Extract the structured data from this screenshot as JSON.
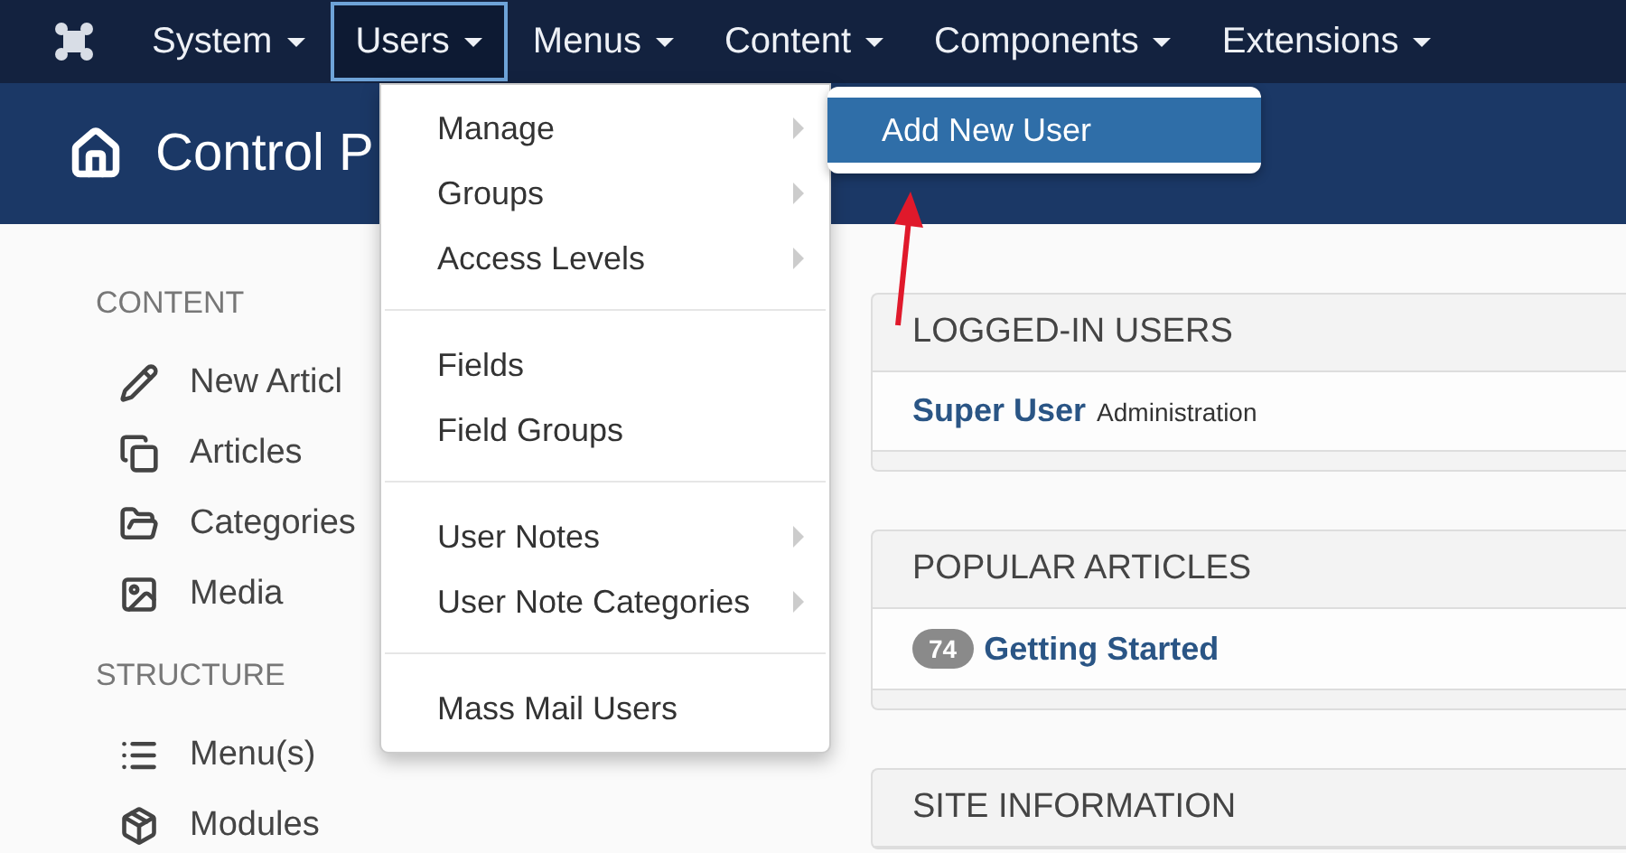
{
  "navbar": {
    "menus": [
      {
        "label": "System",
        "selected": false
      },
      {
        "label": "Users",
        "selected": true
      },
      {
        "label": "Menus",
        "selected": false
      },
      {
        "label": "Content",
        "selected": false
      },
      {
        "label": "Components",
        "selected": false
      },
      {
        "label": "Extensions",
        "selected": false
      }
    ]
  },
  "header": {
    "title": "Control P"
  },
  "users_menu": {
    "groups": [
      [
        {
          "label": "Manage",
          "has_submenu": true
        },
        {
          "label": "Groups",
          "has_submenu": true
        },
        {
          "label": "Access Levels",
          "has_submenu": true
        }
      ],
      [
        {
          "label": "Fields",
          "has_submenu": false
        },
        {
          "label": "Field Groups",
          "has_submenu": false
        }
      ],
      [
        {
          "label": "User Notes",
          "has_submenu": true
        },
        {
          "label": "User Note Categories",
          "has_submenu": true
        }
      ],
      [
        {
          "label": "Mass Mail Users",
          "has_submenu": false
        }
      ]
    ]
  },
  "submenu": {
    "items": [
      {
        "label": "Add New User",
        "selected": true
      }
    ]
  },
  "sidebar": {
    "sections": [
      {
        "title": "CONTENT",
        "items": [
          "New Articl",
          "Articles",
          "Categories",
          "Media"
        ]
      },
      {
        "title": "STRUCTURE",
        "items": [
          "Menu(s)",
          "Modules"
        ]
      }
    ]
  },
  "panels": [
    {
      "title": "LOGGED-IN USERS",
      "rows": [
        {
          "link": "Super User",
          "note": "Administration"
        }
      ]
    },
    {
      "title": "POPULAR ARTICLES",
      "rows": [
        {
          "badge": "74",
          "link": "Getting Started"
        }
      ]
    },
    {
      "title": "SITE INFORMATION"
    }
  ]
}
